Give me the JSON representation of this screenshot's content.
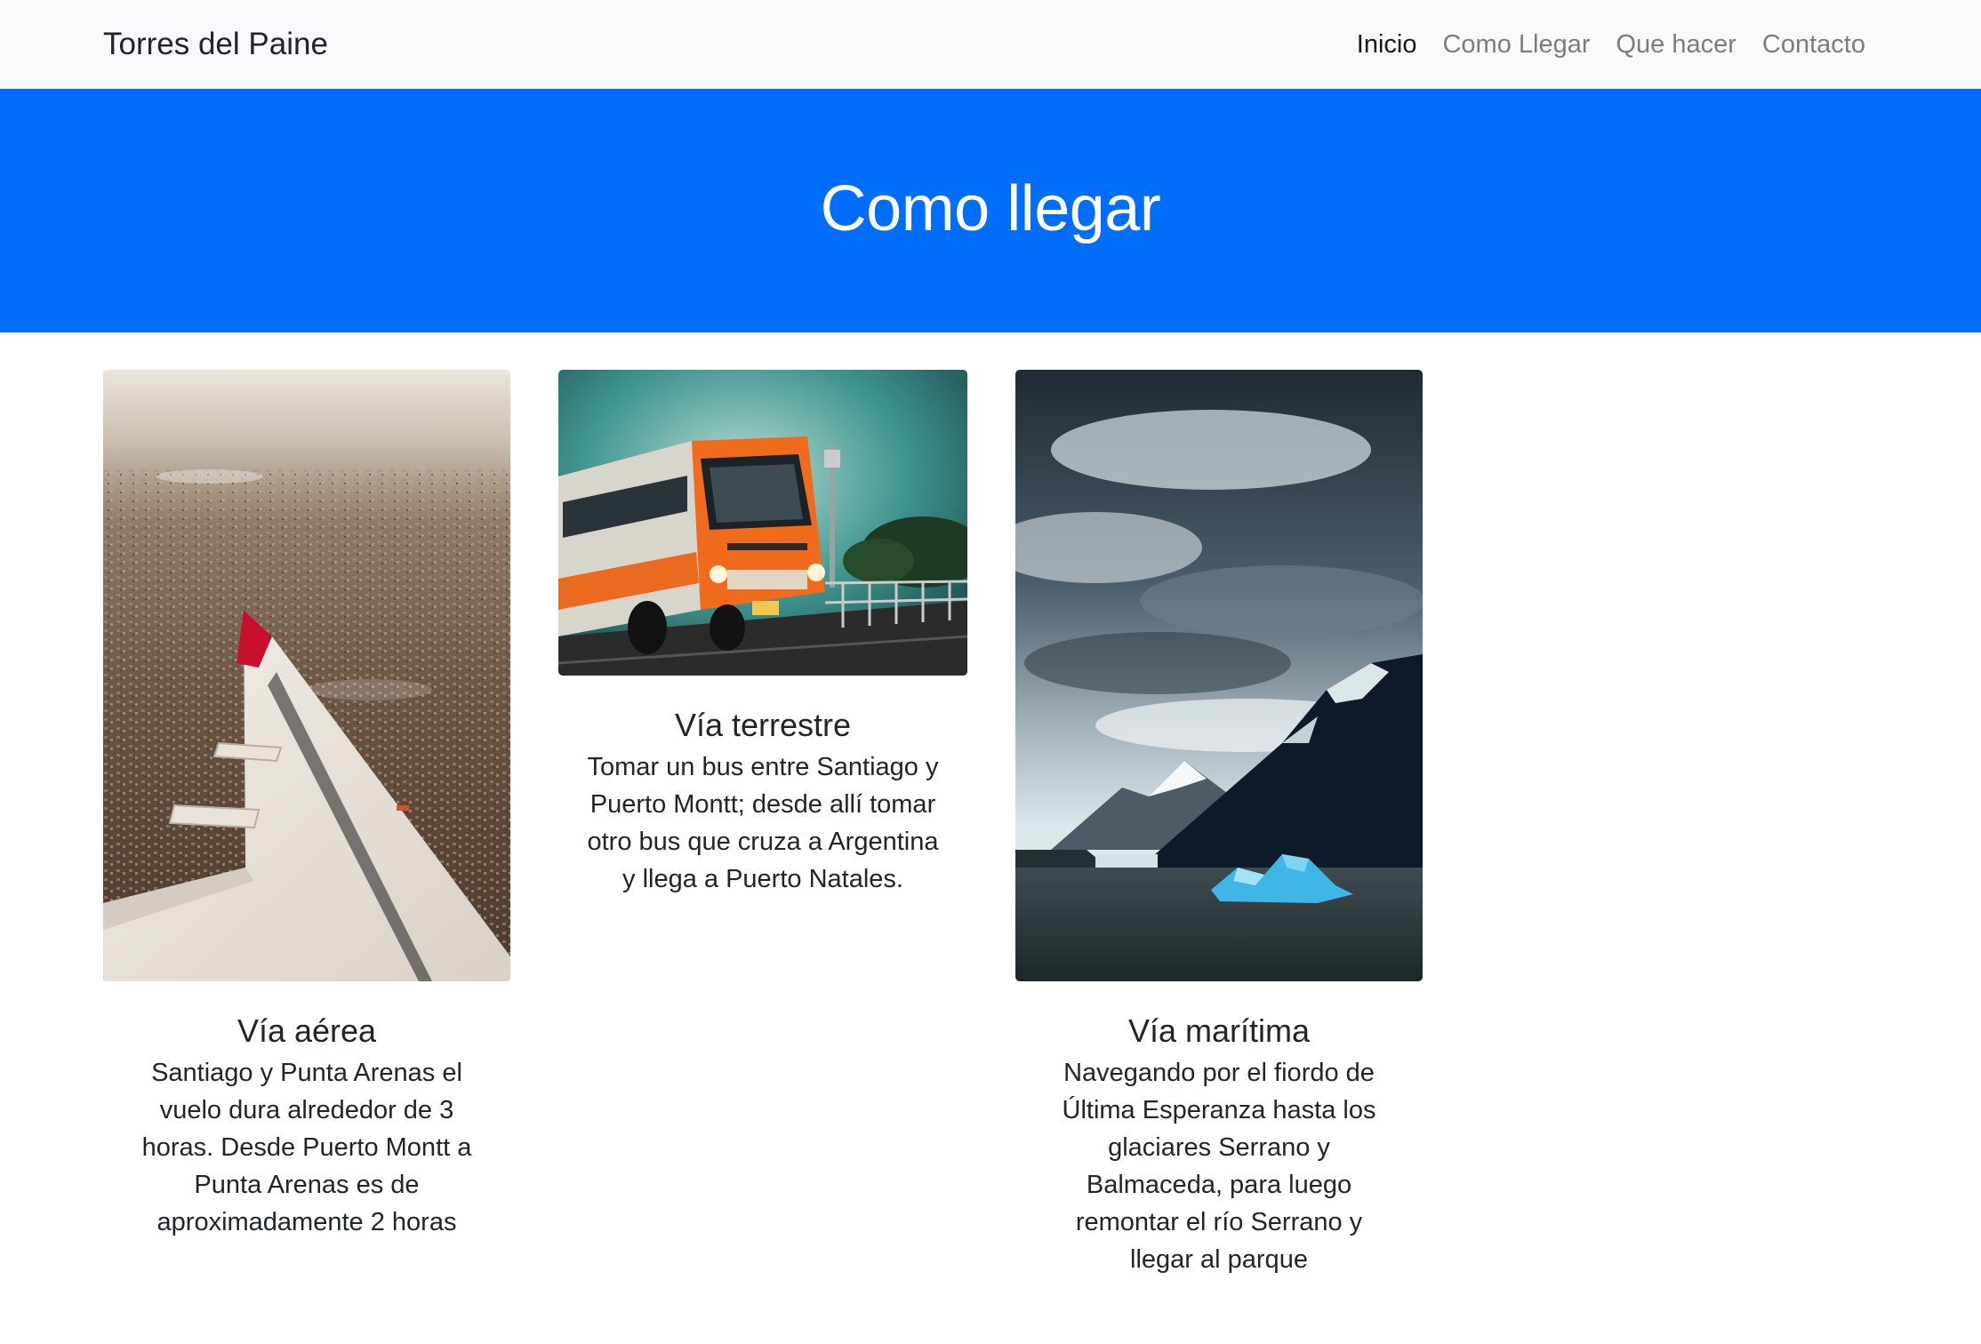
{
  "navbar": {
    "brand": "Torres del Paine",
    "links": [
      {
        "label": "Inicio",
        "active": true
      },
      {
        "label": "Como Llegar",
        "active": false
      },
      {
        "label": "Que hacer",
        "active": false
      },
      {
        "label": "Contacto",
        "active": false
      }
    ]
  },
  "hero": {
    "title": "Como llegar",
    "background_color": "#006dfb"
  },
  "cards": [
    {
      "title": "Vía aérea",
      "text": "Santiago y Punta Arenas el vuelo dura alrededor de 3 horas. Desde Puerto Montt a Punta Arenas es de aproximadamente 2 horas",
      "image": "airplane-wing-photo"
    },
    {
      "title": "Vía terrestre",
      "text": "Tomar un bus entre Santiago y Puerto Montt; desde allí tomar otro bus que cruza a Argentina y llega a Puerto Natales.",
      "image": "orange-bus-photo"
    },
    {
      "title": "Vía marítima",
      "text": "Navegando por el fiordo de Última Esperanza hasta los glaciares Serrano y Balmaceda, para luego remontar el río Serrano y llegar al parque",
      "image": "glacier-iceberg-photo"
    }
  ]
}
